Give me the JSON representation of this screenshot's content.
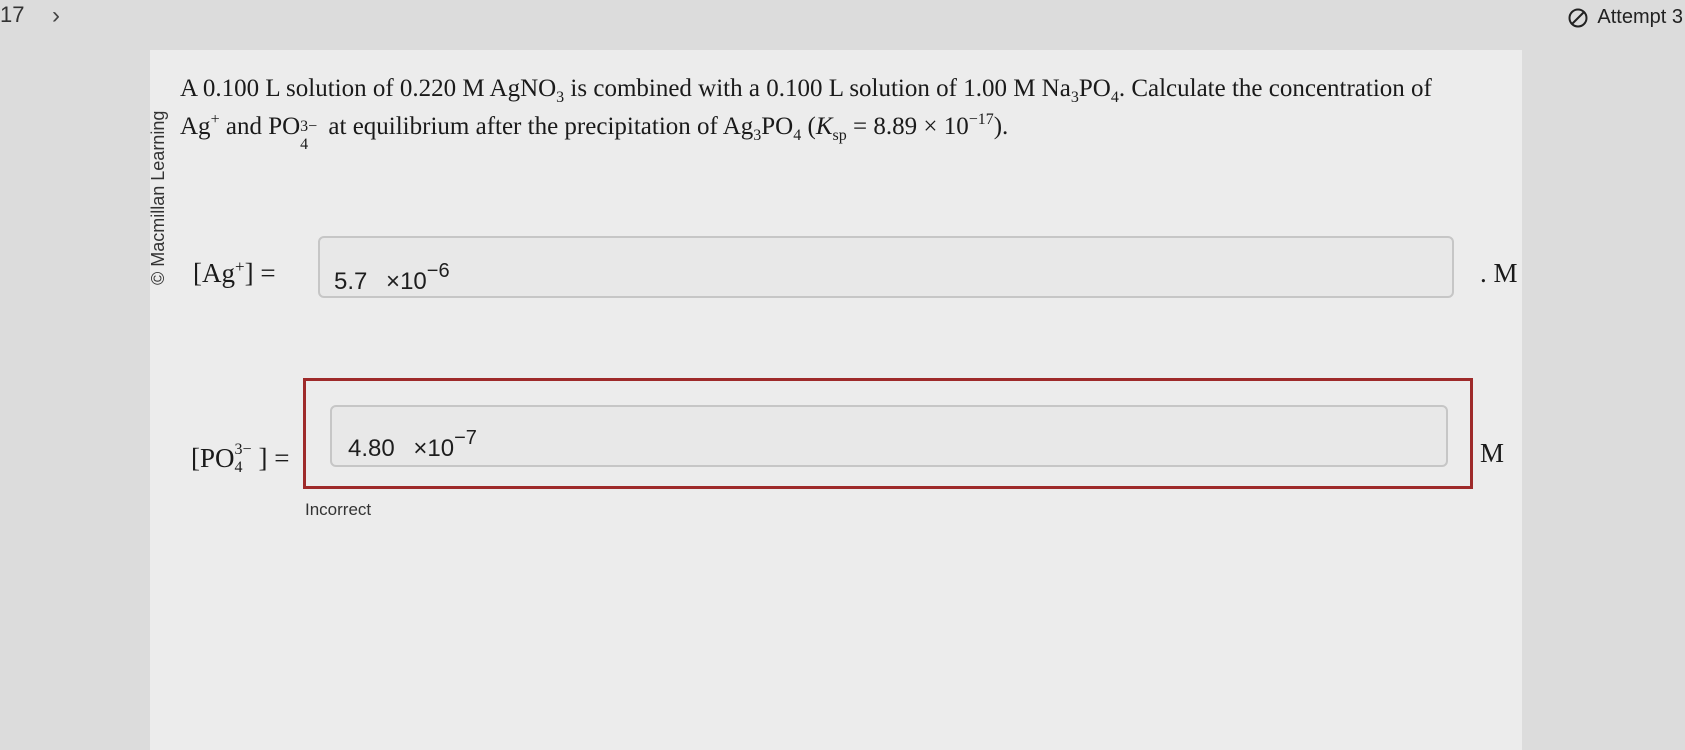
{
  "nav": {
    "question_number": "17",
    "next_glyph": "›"
  },
  "status": {
    "attempt_label": "Attempt 3"
  },
  "publisher": {
    "copyright": "© Macmillan Learning"
  },
  "problem": {
    "t1": "A 0.100 L solution of 0.220 M AgNO",
    "t1_sub": "3",
    "t2": " is combined with a 0.100 L solution of 1.00 M Na",
    "t2_sub": "3",
    "t3": "PO",
    "t3_sub": "4",
    "t4": ". Calculate the concentration of",
    "t5": "Ag",
    "t5_sup": "+",
    "t6": " and PO",
    "t6_sup": "3−",
    "t6_sub": "4",
    "t7": " at equilibrium after the precipitation of Ag",
    "t7_sub": "3",
    "t8": "PO",
    "t8_sub": "4",
    "t9": " (",
    "ksp_k": "K",
    "ksp_sub": "sp",
    "t10": " = 8.89 × 10",
    "t10_sup": "−17",
    "t11": ")."
  },
  "ag": {
    "label_pre": "[Ag",
    "label_sup": "+",
    "label_post": "] =",
    "value_mantissa": "5.7",
    "value_times": "×10",
    "value_exp": "−6",
    "unit": ". M"
  },
  "po4": {
    "label_pre": "[PO",
    "label_sup": "3−",
    "label_sub": "4",
    "label_post": "] =",
    "value_mantissa": "4.80",
    "value_times": "×10",
    "value_exp": "−7",
    "unit": "M",
    "feedback": "Incorrect"
  },
  "colors": {
    "incorrect_border": "#9e2a2a"
  }
}
